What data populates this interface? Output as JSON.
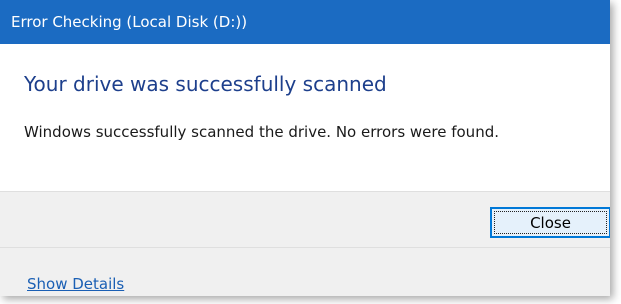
{
  "window": {
    "title": "Error Checking (Local Disk (D:))"
  },
  "content": {
    "main_instruction": "Your drive was successfully scanned",
    "message": "Windows successfully scanned the drive. No errors were found."
  },
  "buttons": {
    "close_label": "Close"
  },
  "footer": {
    "show_details_label": "Show Details"
  },
  "colors": {
    "titlebar": "#1b6bc2",
    "main_instruction": "#1d3f8c",
    "link": "#1a5fb4",
    "button_border": "#0078d7"
  }
}
